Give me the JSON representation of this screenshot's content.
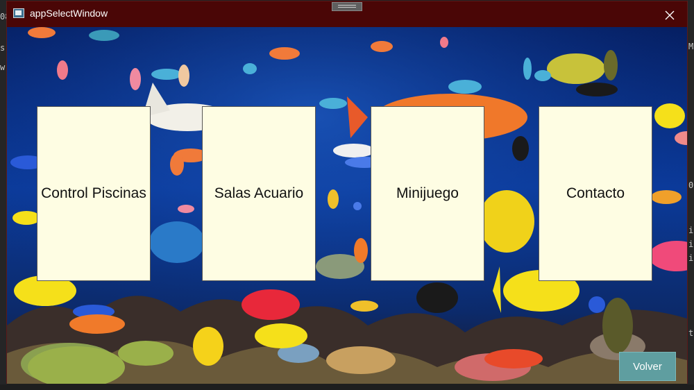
{
  "window": {
    "title": "appSelectWindow",
    "close_icon": "close-icon",
    "app_icon": "window-app-icon"
  },
  "menu": {
    "items": [
      {
        "label": "Control Piscinas"
      },
      {
        "label": "Salas Acuario"
      },
      {
        "label": "Minijuego"
      },
      {
        "label": "Contacto"
      }
    ]
  },
  "footer": {
    "back_label": "Volver"
  },
  "colors": {
    "title_bar": "#4a0606",
    "card_background": "#fefde3",
    "back_button": "#5f9ea0",
    "water": "#0a2e7a"
  }
}
